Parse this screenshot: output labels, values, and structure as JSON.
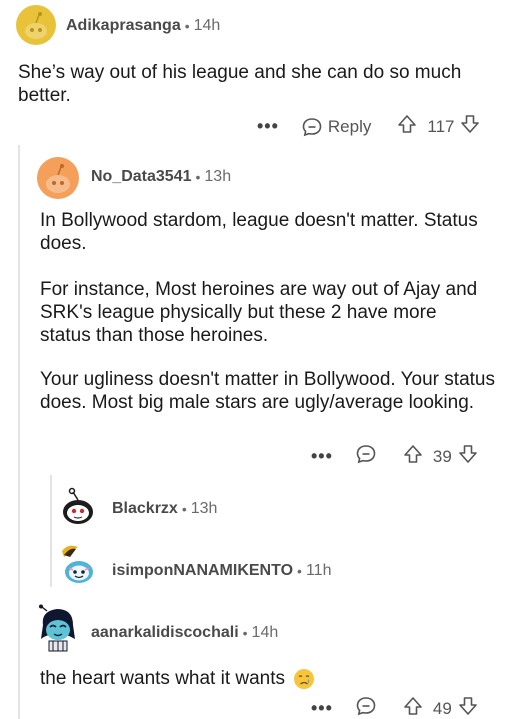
{
  "comments": [
    {
      "username": "Adikaprasanga",
      "age": "14h",
      "body": "She’s way out of his league and she can do so much better.",
      "reply_label": "Reply",
      "votes": "117",
      "avatar_color": "#e8c33a"
    },
    {
      "username": "No_Data3541",
      "age": "13h",
      "paragraphs": [
        "In Bollywood stardom, league doesn't matter. Status does.",
        "For instance, Most heroines are way out of Ajay and SRK's league physically but these 2 have more status than those heroines.",
        "Your ugliness doesn't matter in Bollywood. Your status does. Most big male stars are ugly/average looking."
      ],
      "votes": "39",
      "avatar_color": "#f4a05a"
    },
    {
      "username": "Blackrzx",
      "age": "13h"
    },
    {
      "username": "isimponNANAMIKENTO",
      "age": "11h"
    },
    {
      "username": "aanarkalidiscochali",
      "age": "14h",
      "body": "the heart wants what it wants",
      "votes": "49"
    }
  ],
  "separator": "•",
  "more_label": "•••",
  "colors": {
    "accent_orange": "#ff4500",
    "muted": "#6b6b6b"
  }
}
